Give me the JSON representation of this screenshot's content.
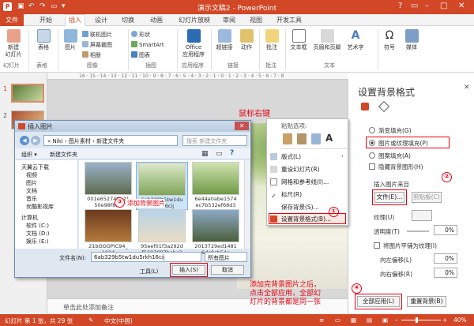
{
  "window": {
    "title": "演示文稿2 - PowerPoint",
    "qa_icons": [
      "save-icon",
      "undo-icon",
      "redo-icon",
      "slideshow-icon"
    ],
    "controls": [
      "?",
      "▭",
      "–",
      "□",
      "✕"
    ]
  },
  "tabs": [
    {
      "label": "文件"
    },
    {
      "label": "开始"
    },
    {
      "label": "插入"
    },
    {
      "label": "设计"
    },
    {
      "label": "切换"
    },
    {
      "label": "动画"
    },
    {
      "label": "幻灯片放映"
    },
    {
      "label": "审阅"
    },
    {
      "label": "视图"
    },
    {
      "label": "开发工具"
    }
  ],
  "ribbon": {
    "new_slide": "新建\n幻灯片",
    "table": "表格",
    "image": "图片",
    "online_pic": "联机图片",
    "screenshot": "屏幕截图",
    "album": "相册",
    "shapes": "形状",
    "smartart": "SmartArt",
    "chart": "图表",
    "office_apps": "Office\n应用程序",
    "hyperlink": "超链接",
    "action": "动作",
    "comment": "批注",
    "textbox": "文本框",
    "header_footer": "页眉和页脚",
    "wordart": "艺术字",
    "symbol": "符号",
    "media": "媒体",
    "groups": {
      "slides": "幻灯片",
      "tables": "表格",
      "images": "图像",
      "illustrations": "插图",
      "apps": "应用程序",
      "links": "链接",
      "comments": "批注",
      "text": "文本"
    }
  },
  "thumbs": [
    {
      "num": "1"
    },
    {
      "num": "2"
    }
  ],
  "ruler": "16 · 15 · 14 · 13 · 12 · 11 · 10 · 9 · 8 · 7 · 6 · 5 · 4 · 3 · 2 · 1 · 0 · 1 · 2 · 3 · 4 · 5 · 6 · 7 · 8",
  "notes_placeholder": "单击此处添加备注",
  "pane": {
    "title": "设置背景格式",
    "gradient": "渐变填充(G)",
    "picture": "图片或纹理填充(P)",
    "pattern": "图案填充(A)",
    "hide": "隐藏背景图形(H)",
    "insert_from": "插入图片来自",
    "file_btn": "文件(E)...",
    "clipboard_btn": "剪贴板(C)",
    "texture": "纹理(U)",
    "transparency": "透明度(T)",
    "tile": "将图片平铺为纹理(I)",
    "offset_left": "向左偏移(L)",
    "offset_right": "向右偏移(R)",
    "pct": "0%",
    "apply_all": "全部应用(L)",
    "reset": "重置背景(B)"
  },
  "ctx": {
    "paste_options": "粘贴选项:",
    "layout": "版式(L)",
    "reset_slide": "重设幻灯片(R)",
    "grid": "网格和参考线(I)...",
    "ruler": "标尺(R)",
    "save_bg": "保存背景(S)...",
    "format_bg": "设置背景格式(B)..."
  },
  "dialog": {
    "title": "插入图片",
    "breadcrumb": "« Niki › 图片素材 › 新建文件夹",
    "search_placeholder": "搜索 新建文件夹",
    "organize": "组织 ▾",
    "new_folder": "新建文件夹",
    "tree": [
      "天翼云下载",
      "视频",
      "图片",
      "文档",
      "音乐",
      "优酷影视库",
      "计算机",
      "软件 (C:)",
      "文档 (D:)",
      "娱乐 (E:)",
      "工作 (F:)"
    ],
    "files": [
      {
        "name": "001e652746e21\n50e98f834"
      },
      {
        "name": "6ab329b5tw1du\n5rkh16cij"
      },
      {
        "name": "6e44a0abe1574\nec7b532ef68d3\n571dfb_th"
      },
      {
        "name": "21bOOOPIC94_\n1024"
      },
      {
        "name": "95eef01f3a292d\nf5697097bebc3"
      },
      {
        "name": "2013729ed1481\n6dc8cb54e"
      }
    ],
    "filename_label": "文件名(N):",
    "filename_value": "6ab329b5tw1du5rkh16cij",
    "filetype": "所有图片",
    "tools": "工具(L)",
    "insert": "插入(S)",
    "cancel": "取消"
  },
  "annotations": {
    "right_click": "鼠标右键",
    "add_bg": "添加背景图片",
    "note": "添加完背景图片之后，\n点击全部应用，全部幻\n灯片的背景都是同一张",
    "n1": "①",
    "n2": "②",
    "n3": "③",
    "n4": "④"
  },
  "status": {
    "slide": "幻灯片 第 1 张，共 29 张",
    "lang": "中文(中国)",
    "zoom": "40%"
  },
  "colors": {
    "accent": "#d24726",
    "annotation": "#e60012"
  }
}
